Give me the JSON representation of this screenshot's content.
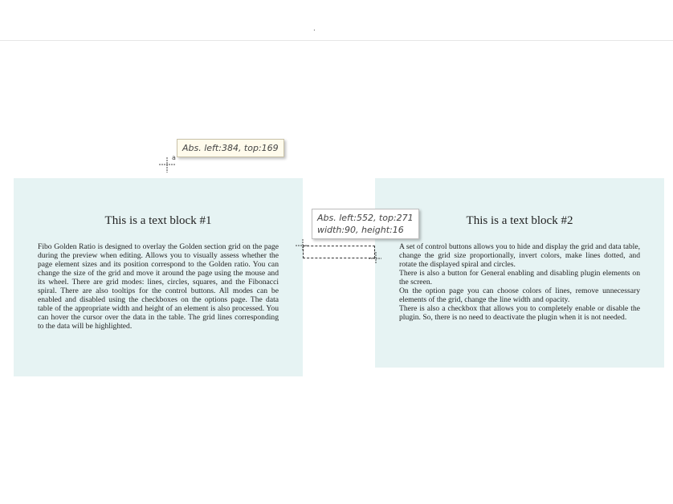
{
  "topbar": {
    "marker": "."
  },
  "tooltips": {
    "anchor": {
      "line1": "Abs. left:384, top:169"
    },
    "element": {
      "line1": "Abs. left:552, top:271",
      "line2": "width:90, height:16"
    }
  },
  "anchor_label": "a",
  "block1": {
    "title": "This is a text block #1",
    "body": "Fibo Golden Ratio is designed to overlay the Golden section grid on the page during the preview when editing.  Allows you to visually assess whether the page element sizes and its position correspond to the Golden ratio. You can change the size of the grid and move it around the page using the mouse and its wheel. There are grid modes: lines, circles, squares, and the Fibonacci spiral. There are also tooltips for the control buttons. All modes can be enabled and disabled using the checkboxes on the options page. The data table of the appropriate width and height of an element is also processed. You can hover the cursor over the data in the table. The grid lines corresponding to the data will be highlighted."
  },
  "block2": {
    "title": "This is a text block #2",
    "paragraphs": [
      "A set of control buttons allows you to hide and display the grid and data table, change the grid size proportionally, invert colors, make lines dotted, and rotate the displayed spiral and circles.",
      "There is also a button for General enabling and disabling plugin elements on the screen.",
      "On the option page you can choose colors of lines, remove unnecessary elements of the grid, change the line width and opacity.",
      "There is also a checkbox that allows you to completely enable or disable the plugin. So, there is no need to deactivate the plugin when it is not needed."
    ]
  },
  "colors": {
    "block_background": "#e6f3f3",
    "tooltip_background": "#fffbec"
  }
}
